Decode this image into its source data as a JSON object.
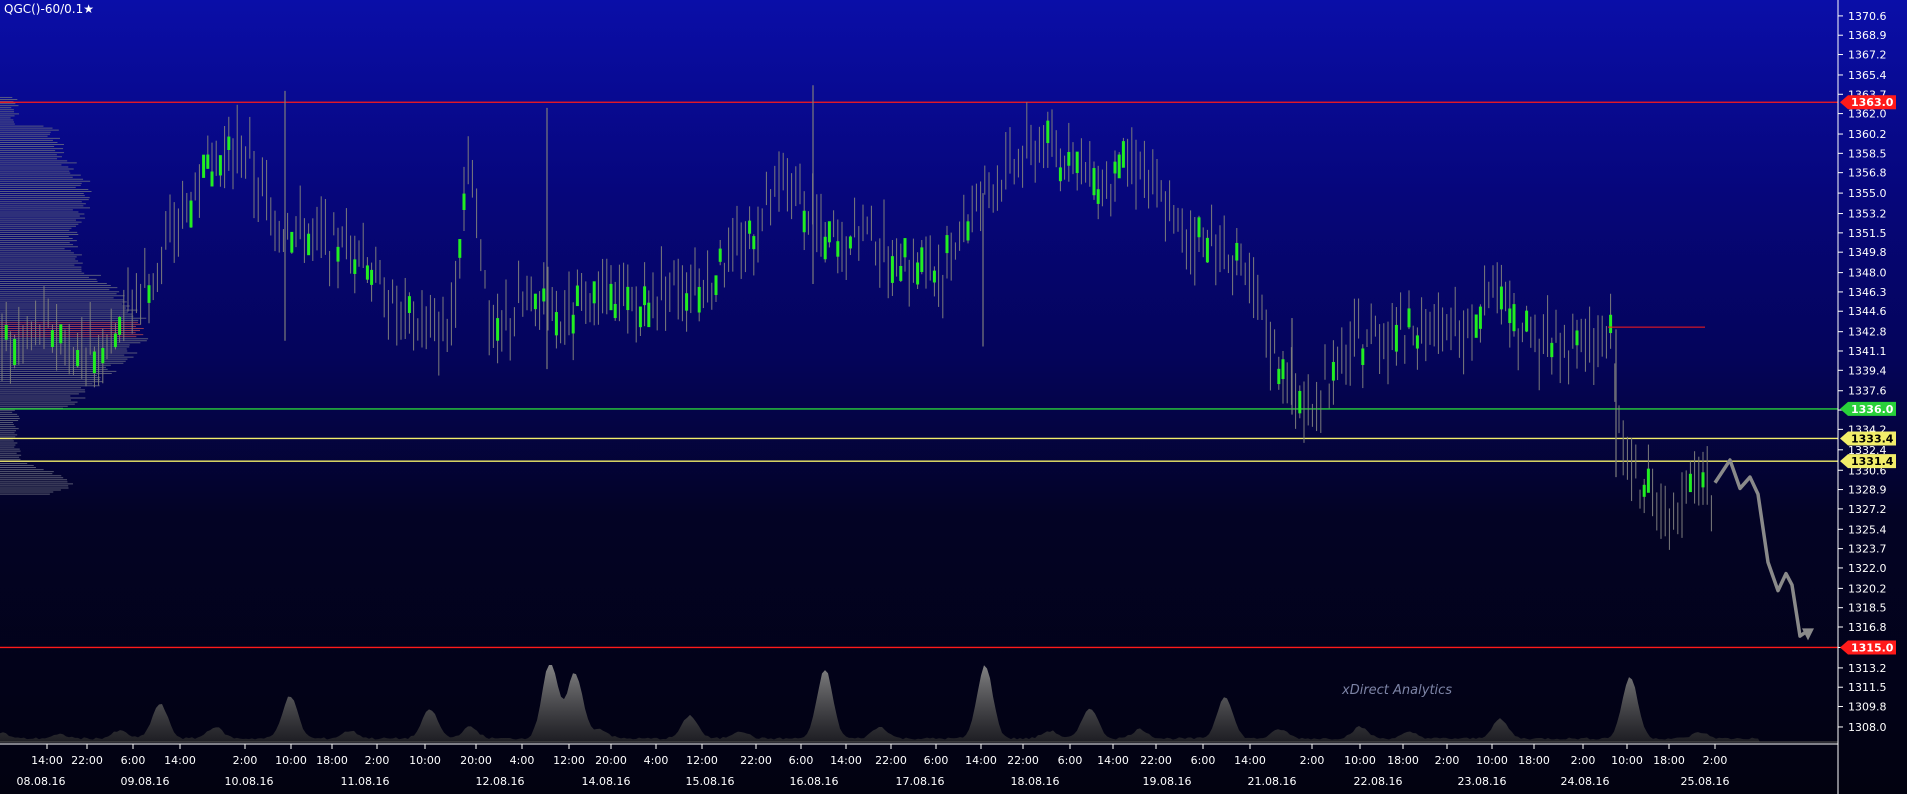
{
  "symbol_title": "QGC()-60/0.1",
  "star_icon": "star-icon",
  "watermark": "xDirect Analytics",
  "colors": {
    "resistance": "#ff1a1a",
    "support_green": "#29d13a",
    "yellow_level": "#f2ee6a",
    "candle": "#7c7c7c",
    "bull_body": "#22ee22",
    "forecast_path": "#8a8a8a"
  },
  "chart_data": {
    "type": "candlestick",
    "ylim": [
      1306.5,
      1372
    ],
    "y_ticks": [
      "1370.6",
      "1368.9",
      "1367.2",
      "1365.4",
      "1363.7",
      "1362.0",
      "1360.2",
      "1358.5",
      "1356.8",
      "1355.0",
      "1353.2",
      "1351.5",
      "1349.8",
      "1348.0",
      "1346.3",
      "1344.6",
      "1342.8",
      "1341.1",
      "1339.4",
      "1337.6",
      "1335.9",
      "1334.2",
      "1332.4",
      "1330.6",
      "1328.9",
      "1327.2",
      "1325.4",
      "1323.7",
      "1322.0",
      "1320.2",
      "1318.5",
      "1316.8",
      "1315.0",
      "1313.2",
      "1311.5",
      "1309.8",
      "1308.0"
    ],
    "x_ticks_time": [
      "14:00",
      "22:00",
      "6:00",
      "14:00",
      "2:00",
      "10:00",
      "18:00",
      "2:00",
      "10:00",
      "20:00",
      "4:00",
      "12:00",
      "20:00",
      "4:00",
      "12:00",
      "22:00",
      "6:00",
      "14:00",
      "22:00",
      "6:00",
      "14:00",
      "22:00",
      "6:00",
      "14:00",
      "22:00",
      "6:00",
      "14:00",
      "2:00",
      "10:00",
      "18:00",
      "2:00",
      "10:00",
      "18:00",
      "2:00",
      "10:00",
      "18:00",
      "2:00"
    ],
    "x_ticks_date": [
      "08.08.16",
      "09.08.16",
      "10.08.16",
      "11.08.16",
      "12.08.16",
      "14.08.16",
      "15.08.16",
      "16.08.16",
      "17.08.16",
      "18.08.16",
      "19.08.16",
      "21.08.16",
      "22.08.16",
      "23.08.16",
      "24.08.16",
      "25.08.16"
    ],
    "levels": [
      {
        "value": 1363.0,
        "label": "1363.0",
        "kind": "resistance"
      },
      {
        "value": 1336.0,
        "label": "1336.0",
        "kind": "support_green"
      },
      {
        "value": 1333.4,
        "label": "1333.4",
        "kind": "yellow_level"
      },
      {
        "value": 1331.4,
        "label": "1331.4",
        "kind": "yellow_level"
      },
      {
        "value": 1315.0,
        "label": "1315.0",
        "kind": "resistance"
      }
    ],
    "price_anchors": [
      [
        0,
        1341.0
      ],
      [
        40,
        1343.0
      ],
      [
        100,
        1341.5
      ],
      [
        150,
        1347.5
      ],
      [
        200,
        1356.0
      ],
      [
        240,
        1359.0
      ],
      [
        280,
        1352.0
      ],
      [
        320,
        1351.0
      ],
      [
        360,
        1349.5
      ],
      [
        400,
        1344.0
      ],
      [
        450,
        1343.0
      ],
      [
        470,
        1360.0
      ],
      [
        490,
        1342.5
      ],
      [
        530,
        1345.5
      ],
      [
        560,
        1343.5
      ],
      [
        600,
        1346.0
      ],
      [
        640,
        1344.5
      ],
      [
        670,
        1347.5
      ],
      [
        700,
        1346.0
      ],
      [
        740,
        1350.0
      ],
      [
        790,
        1356.0
      ],
      [
        830,
        1350.5
      ],
      [
        870,
        1351.5
      ],
      [
        900,
        1349.0
      ],
      [
        940,
        1348.0
      ],
      [
        980,
        1354.5
      ],
      [
        1010,
        1357.0
      ],
      [
        1040,
        1359.5
      ],
      [
        1080,
        1356.5
      ],
      [
        1110,
        1356.0
      ],
      [
        1140,
        1358.0
      ],
      [
        1170,
        1352.5
      ],
      [
        1200,
        1351.0
      ],
      [
        1230,
        1350.0
      ],
      [
        1260,
        1344.0
      ],
      [
        1290,
        1337.5
      ],
      [
        1310,
        1337.0
      ],
      [
        1330,
        1338.5
      ],
      [
        1360,
        1342.0
      ],
      [
        1400,
        1343.0
      ],
      [
        1440,
        1342.5
      ],
      [
        1470,
        1344.0
      ],
      [
        1500,
        1347.5
      ],
      [
        1520,
        1343.0
      ],
      [
        1550,
        1342.0
      ],
      [
        1580,
        1341.0
      ],
      [
        1610,
        1342.5
      ],
      [
        1620,
        1335.0
      ],
      [
        1628,
        1331.0
      ],
      [
        1640,
        1329.0
      ],
      [
        1660,
        1327.5
      ],
      [
        1690,
        1328.5
      ],
      [
        1715,
        1329.5
      ]
    ],
    "spikes": [
      {
        "x": 285,
        "high": 1364.0,
        "low": 1342.0
      },
      {
        "x": 547,
        "high": 1362.5,
        "low": 1339.5
      },
      {
        "x": 813,
        "high": 1364.5,
        "low": 1347.0
      },
      {
        "x": 983,
        "high": 1355.0,
        "low": 1341.5
      },
      {
        "x": 1292,
        "high": 1344.0,
        "low": 1335.5
      },
      {
        "x": 1616,
        "high": 1343.0,
        "low": 1330.0
      }
    ],
    "forecast_path": [
      [
        1715,
        1329.5
      ],
      [
        1730,
        1331.5
      ],
      [
        1740,
        1329.0
      ],
      [
        1750,
        1330.0
      ],
      [
        1758,
        1328.5
      ],
      [
        1768,
        1322.5
      ],
      [
        1778,
        1320.0
      ],
      [
        1786,
        1321.5
      ],
      [
        1792,
        1320.5
      ],
      [
        1800,
        1316.0
      ],
      [
        1808,
        1316.5
      ]
    ],
    "volume_peaks": [
      [
        0,
        0.08
      ],
      [
        60,
        0.05
      ],
      [
        120,
        0.1
      ],
      [
        160,
        0.45
      ],
      [
        215,
        0.15
      ],
      [
        290,
        0.55
      ],
      [
        350,
        0.1
      ],
      [
        430,
        0.38
      ],
      [
        470,
        0.15
      ],
      [
        550,
        1.0
      ],
      [
        575,
        0.85
      ],
      [
        600,
        0.12
      ],
      [
        690,
        0.3
      ],
      [
        740,
        0.1
      ],
      [
        825,
        0.9
      ],
      [
        880,
        0.15
      ],
      [
        985,
        0.95
      ],
      [
        1050,
        0.1
      ],
      [
        1090,
        0.4
      ],
      [
        1140,
        0.12
      ],
      [
        1225,
        0.55
      ],
      [
        1280,
        0.12
      ],
      [
        1360,
        0.15
      ],
      [
        1410,
        0.08
      ],
      [
        1500,
        0.25
      ],
      [
        1630,
        0.8
      ],
      [
        1700,
        0.08
      ]
    ],
    "volume_profile_peak": 1343.0,
    "red_marker": {
      "x1": 1608,
      "x2": 1705,
      "value": 1343.2
    }
  }
}
